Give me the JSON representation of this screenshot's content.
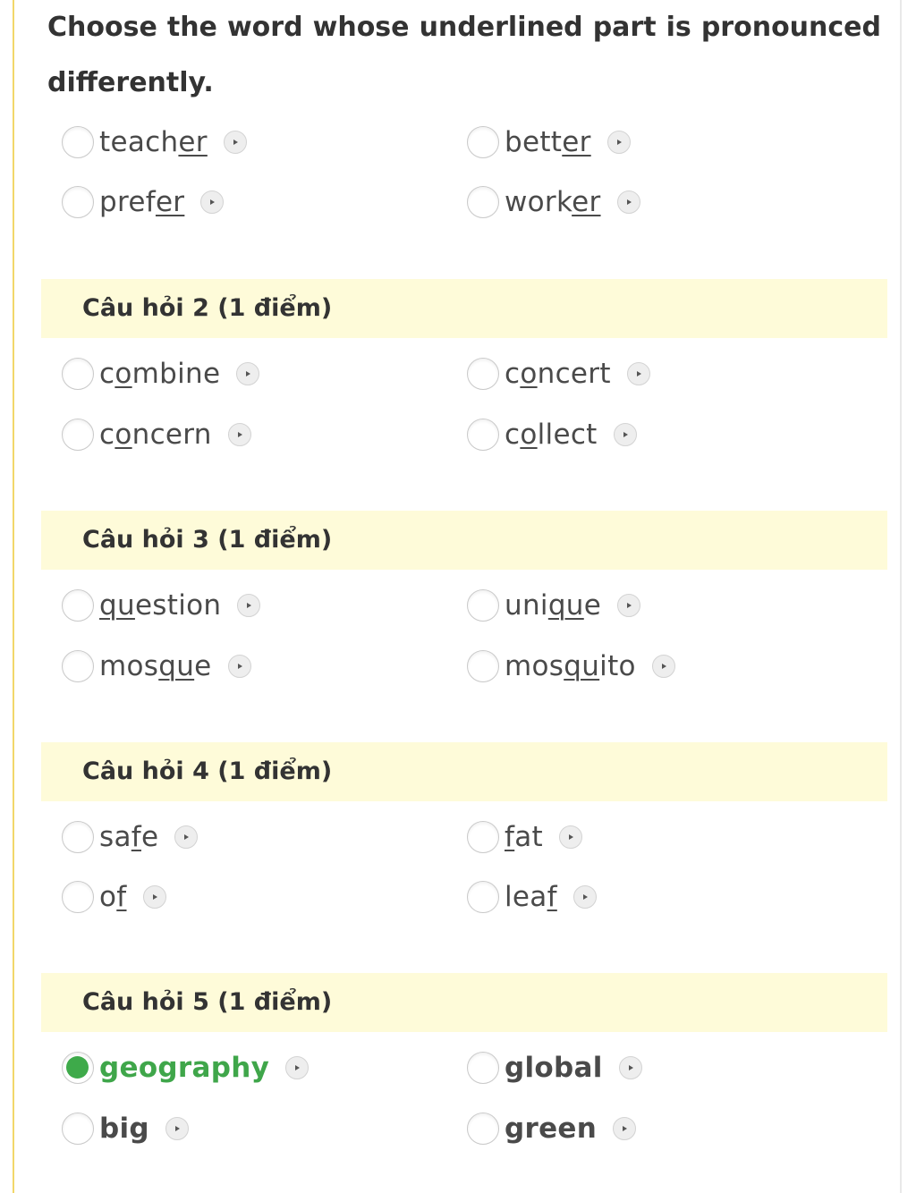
{
  "instruction": "Choose the word whose underlined part is pronounced differently.",
  "question_1": {
    "options": [
      {
        "pre": "teach",
        "u": "er",
        "post": ""
      },
      {
        "pre": "bett",
        "u": "er",
        "post": ""
      },
      {
        "pre": "pref",
        "u": "er",
        "post": ""
      },
      {
        "pre": "work",
        "u": "er",
        "post": ""
      }
    ]
  },
  "question_2": {
    "header": "Câu hỏi 2 (1 điểm)",
    "options": [
      {
        "pre": "c",
        "u": "o",
        "post": "mbine"
      },
      {
        "pre": "c",
        "u": "o",
        "post": "ncert"
      },
      {
        "pre": "c",
        "u": "o",
        "post": "ncern"
      },
      {
        "pre": "c",
        "u": "o",
        "post": "llect"
      }
    ]
  },
  "question_3": {
    "header": "Câu hỏi 3 (1 điểm)",
    "options": [
      {
        "pre": "",
        "u": "qu",
        "post": "estion"
      },
      {
        "pre": "uni",
        "u": "qu",
        "post": "e"
      },
      {
        "pre": "mos",
        "u": "qu",
        "post": "e"
      },
      {
        "pre": "mos",
        "u": "qu",
        "post": "ito"
      }
    ]
  },
  "question_4": {
    "header": "Câu hỏi 4 (1 điểm)",
    "options": [
      {
        "pre": "sa",
        "u": "f",
        "post": "e"
      },
      {
        "pre": "",
        "u": "f",
        "post": "at"
      },
      {
        "pre": "o",
        "u": "f",
        "post": ""
      },
      {
        "pre": "lea",
        "u": "f",
        "post": ""
      }
    ]
  },
  "question_5": {
    "header": "Câu hỏi 5 (1 điểm)",
    "options": [
      {
        "pre": "",
        "u": "",
        "post": "geography",
        "selected": true
      },
      {
        "pre": "",
        "u": "",
        "post": "global"
      },
      {
        "pre": "",
        "u": "",
        "post": "big"
      },
      {
        "pre": "",
        "u": "",
        "post": "green"
      }
    ]
  },
  "colors": {
    "header_bg": "#fefbd9",
    "frame": "#f2d76b",
    "selected": "#3eaa4a"
  },
  "icons": {
    "speaker": "play-circle-icon"
  }
}
